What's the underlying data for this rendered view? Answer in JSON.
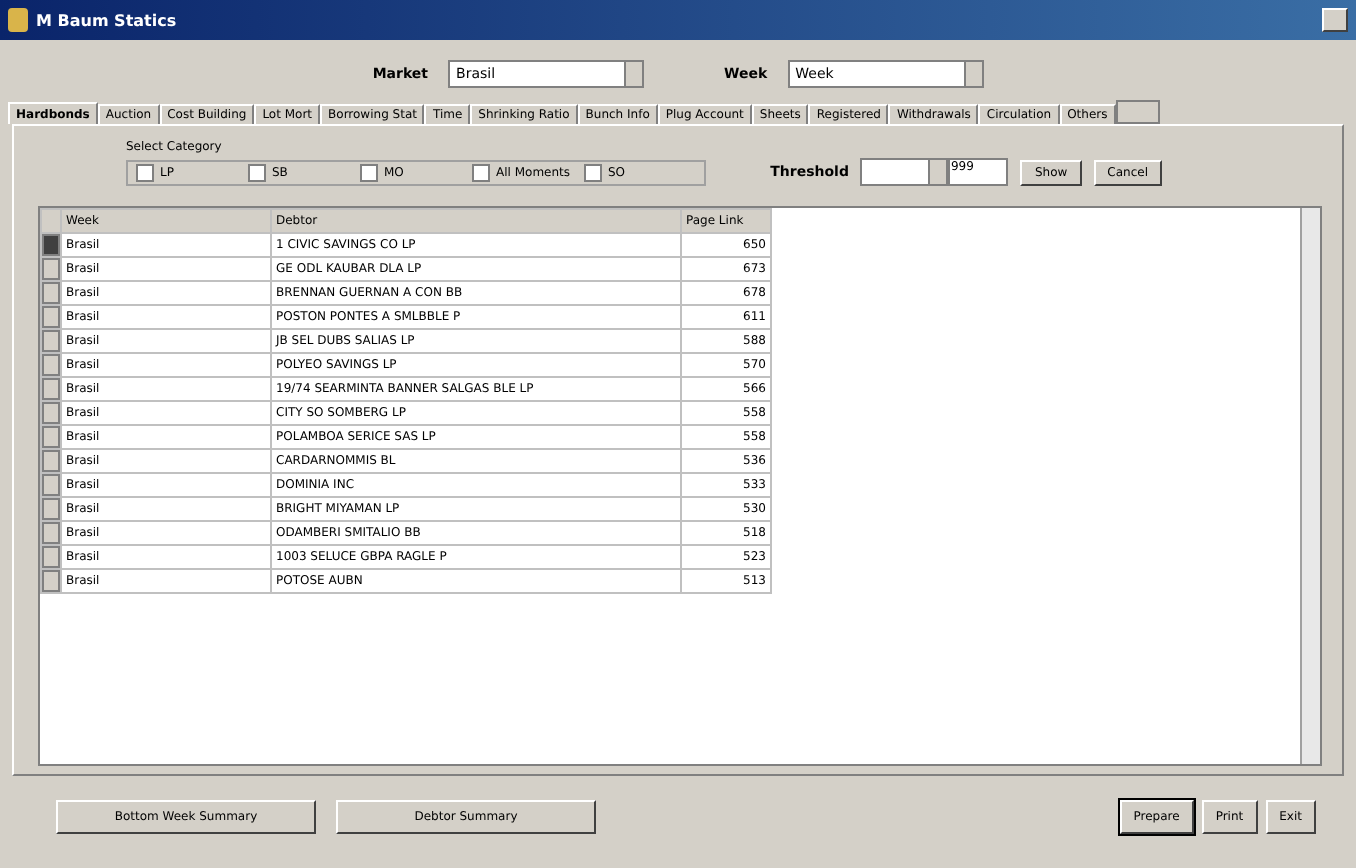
{
  "window": {
    "title": "M Baum Statics"
  },
  "filters": [
    {
      "label": "Market",
      "value": "Brasil"
    },
    {
      "label": "Week",
      "value": "Week"
    }
  ],
  "tabs": [
    {
      "label": "Hardbonds",
      "selected": true
    },
    {
      "label": "Auction",
      "selected": false
    },
    {
      "label": "Cost Building",
      "selected": false
    },
    {
      "label": "Lot Mort",
      "selected": false
    },
    {
      "label": "Borrowing Stat",
      "selected": false
    },
    {
      "label": "Time",
      "selected": false
    },
    {
      "label": "Shrinking Ratio",
      "selected": false
    },
    {
      "label": "Bunch Info",
      "selected": false
    },
    {
      "label": "Plug Account",
      "selected": false
    },
    {
      "label": "Sheets",
      "selected": false
    },
    {
      "label": "Registered",
      "selected": false
    },
    {
      "label": "Withdrawals",
      "selected": false
    },
    {
      "label": "Circulation",
      "selected": false
    },
    {
      "label": "Others",
      "selected": false
    }
  ],
  "category": {
    "title": "Select Category",
    "options": [
      {
        "label": "LP",
        "checked": false
      },
      {
        "label": "SB",
        "checked": false
      },
      {
        "label": "MO",
        "checked": false
      },
      {
        "label": "All Moments",
        "checked": false
      },
      {
        "label": "SO",
        "checked": false
      }
    ]
  },
  "threshold": {
    "label": "Threshold",
    "to": "999"
  },
  "panel_buttons": [
    "Show",
    "Cancel"
  ],
  "table": {
    "columns": [
      "Week",
      "Debtor",
      "Page Link"
    ],
    "rows": [
      {
        "selected": true,
        "cells": [
          "Brasil",
          "1 CIVIC SAVINGS CO LP",
          "650"
        ]
      },
      {
        "selected": false,
        "cells": [
          "Brasil",
          "GE ODL KAUBAR DLA LP",
          "673"
        ]
      },
      {
        "selected": false,
        "cells": [
          "Brasil",
          "BRENNAN GUERNAN A CON BB",
          "678"
        ]
      },
      {
        "selected": false,
        "cells": [
          "Brasil",
          "POSTON PONTES A SMLBBLE P",
          "611"
        ]
      },
      {
        "selected": false,
        "cells": [
          "Brasil",
          "JB SEL DUBS SALIAS LP",
          "588"
        ]
      },
      {
        "selected": false,
        "cells": [
          "Brasil",
          "POLYEO SAVINGS LP",
          "570"
        ]
      },
      {
        "selected": false,
        "cells": [
          "Brasil",
          "19/74 SEARMINTA BANNER SALGAS BLE LP",
          "566"
        ]
      },
      {
        "selected": false,
        "cells": [
          "Brasil",
          "CITY SO SOMBERG LP",
          "558"
        ]
      },
      {
        "selected": false,
        "cells": [
          "Brasil",
          "POLAMBOA SERICE SAS LP",
          "558"
        ]
      },
      {
        "selected": false,
        "cells": [
          "Brasil",
          "CARDARNOMMIS BL",
          "536"
        ]
      },
      {
        "selected": false,
        "cells": [
          "Brasil",
          "DOMINIA INC",
          "533"
        ]
      },
      {
        "selected": false,
        "cells": [
          "Brasil",
          "BRIGHT MIYAMAN LP",
          "530"
        ]
      },
      {
        "selected": false,
        "cells": [
          "Brasil",
          "ODAMBERI SMITALIO BB",
          "518"
        ]
      },
      {
        "selected": false,
        "cells": [
          "Brasil",
          "1003 SELUCE GBPA RAGLE P",
          "523"
        ]
      },
      {
        "selected": false,
        "cells": [
          "Brasil",
          "POTOSE AUBN",
          "513"
        ]
      }
    ]
  },
  "bottom_left_buttons": [
    "Bottom Week Summary",
    "Debtor Summary"
  ],
  "bottom_right_buttons": [
    {
      "label": "Prepare",
      "selected": true
    },
    {
      "label": "Print",
      "selected": false
    },
    {
      "label": "Exit",
      "selected": false
    }
  ]
}
